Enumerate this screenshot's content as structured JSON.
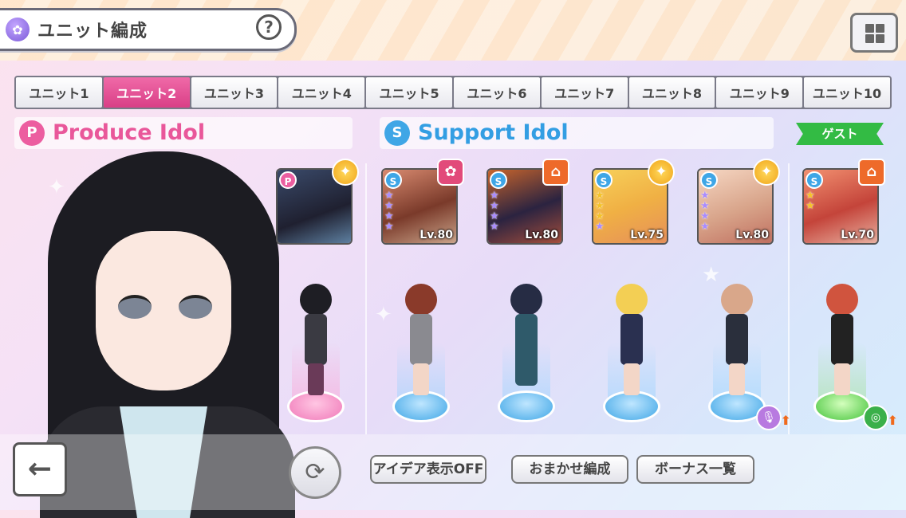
{
  "header": {
    "title": "ユニット編成",
    "help_label": "?",
    "menu_icon": "grid-menu-icon"
  },
  "tabs": [
    {
      "label": "ユニット1",
      "active": false
    },
    {
      "label": "ユニット2",
      "active": true
    },
    {
      "label": "ユニット3",
      "active": false
    },
    {
      "label": "ユニット4",
      "active": false
    },
    {
      "label": "ユニット5",
      "active": false
    },
    {
      "label": "ユニット6",
      "active": false
    },
    {
      "label": "ユニット7",
      "active": false
    },
    {
      "label": "ユニット8",
      "active": false
    },
    {
      "label": "ユニット9",
      "active": false
    },
    {
      "label": "ユニット10",
      "active": false
    }
  ],
  "sections": {
    "produce": {
      "badge": "P",
      "label": "Produce Idol"
    },
    "support": {
      "badge": "S",
      "label": "Support Idol"
    },
    "guest_label": "ゲスト"
  },
  "produce_card": {
    "badge": "P",
    "type": "star"
  },
  "support_cards": [
    {
      "level": "Lv.80",
      "type": "flower",
      "stars": [
        "purple",
        "purple",
        "purple",
        "purple"
      ]
    },
    {
      "level": "Lv.80",
      "type": "school",
      "stars": [
        "purple",
        "purple",
        "purple",
        "purple"
      ]
    },
    {
      "level": "Lv.75",
      "type": "star",
      "stars": [
        "on",
        "on",
        "on",
        "purple"
      ]
    },
    {
      "level": "Lv.80",
      "type": "star",
      "stars": [
        "purple",
        "purple",
        "purple",
        "purple"
      ]
    },
    {
      "level": "Lv.70",
      "type": "school",
      "stars": [
        "on",
        "on",
        "off",
        "off"
      ]
    }
  ],
  "footer": {
    "back_label": "←",
    "refresh_label": "⟳",
    "idea_toggle": "アイデア表示OFF",
    "auto_form": "おまかせ編成",
    "bonus_list": "ボーナス一覧"
  },
  "colors": {
    "active_tab": "#e04c8e",
    "produce": "#e9579a",
    "support": "#339ee3",
    "guest": "#33bb44"
  }
}
